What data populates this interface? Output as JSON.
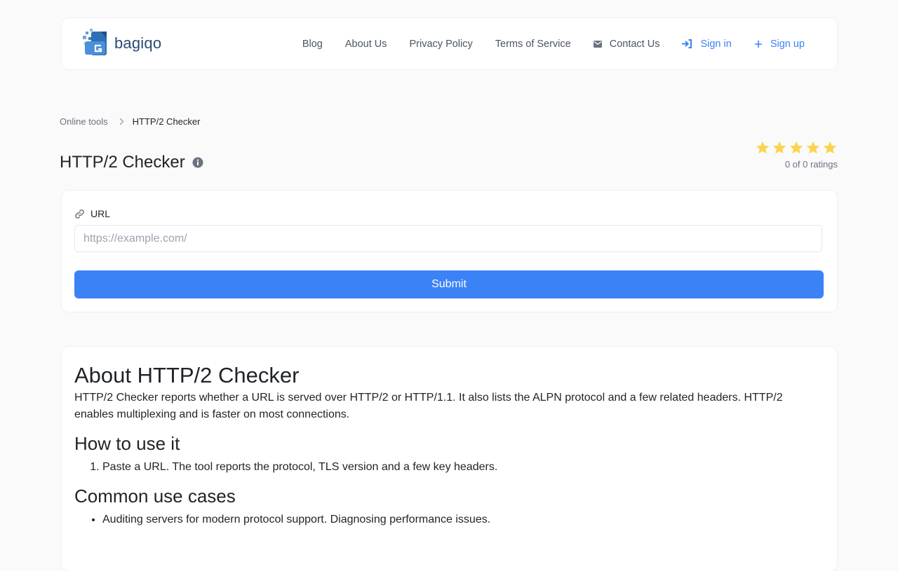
{
  "brand": {
    "name": "bagiqo"
  },
  "nav": {
    "links": [
      {
        "label": "Blog"
      },
      {
        "label": "About Us"
      },
      {
        "label": "Privacy Policy"
      },
      {
        "label": "Terms of Service"
      },
      {
        "label": "Contact Us",
        "icon": "envelope-icon"
      },
      {
        "label": "Sign in",
        "icon": "sign-in-icon"
      },
      {
        "label": "Sign up",
        "icon": "plus-icon"
      }
    ]
  },
  "breadcrumb": {
    "parent": "Online tools",
    "current": "HTTP/2 Checker"
  },
  "page": {
    "title": "HTTP/2 Checker",
    "info_icon": "info-circle-icon"
  },
  "rating": {
    "stars": 5,
    "text": "0 of 0 ratings",
    "star_color": "#fcd34d"
  },
  "form": {
    "label": "URL",
    "label_icon": "link-icon",
    "placeholder": "https://example.com/",
    "value": "",
    "submit_label": "Submit"
  },
  "about": {
    "title": "About HTTP/2 Checker",
    "description": "HTTP/2 Checker reports whether a URL is served over HTTP/2 or HTTP/1.1. It also lists the ALPN protocol and a few related headers. HTTP/2 enables multiplexing and is faster on most connections.",
    "how_to_title": "How to use it",
    "how_to_steps": [
      "Paste a URL. The tool reports the protocol, TLS version and a few key headers."
    ],
    "use_cases_title": "Common use cases",
    "use_cases": [
      "Auditing servers for modern protocol support. Diagnosing performance issues."
    ]
  },
  "colors": {
    "accent": "#3b82f6",
    "text": "#1f2328",
    "muted": "#6b7280",
    "background": "#fafafa"
  }
}
